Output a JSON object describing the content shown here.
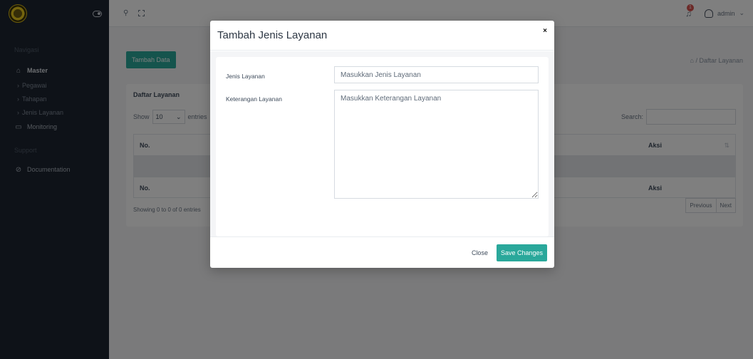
{
  "colors": {
    "accent": "#2aa89b",
    "sidebar_bg": "#1d2531",
    "badge": "#d9534f"
  },
  "sidebar": {
    "section_nav": "Navigasi",
    "master_label": "Master",
    "sub_items": [
      {
        "label": "Pegawai"
      },
      {
        "label": "Tahapan"
      },
      {
        "label": "Jenis Layanan"
      }
    ],
    "monitoring_label": "Monitoring",
    "section_support": "Support",
    "documentation_label": "Documentation"
  },
  "topbar": {
    "notif_count": "1",
    "user_name": "admin"
  },
  "page": {
    "add_button": "Tambah Data",
    "breadcrumb": "/ Daftar Layanan",
    "card_title": "Daftar Layanan",
    "show_label": "Show",
    "show_value": "10",
    "entries_label": "entries",
    "search_label": "Search:",
    "col_no": "No.",
    "col_aksi": "Aksi",
    "showing_text": "Showing 0 to 0 of 0 entries",
    "prev_label": "Previous",
    "next_label": "Next"
  },
  "modal": {
    "title": "Tambah Jenis Layanan",
    "close_x": "×",
    "field1_label": "Jenis Layanan",
    "field1_placeholder": "Masukkan Jenis Layanan",
    "field2_label": "Keterangan Layanan",
    "field2_placeholder": "Masukkan Keterangan Layanan",
    "close_button": "Close",
    "save_button": "Save Changes"
  }
}
